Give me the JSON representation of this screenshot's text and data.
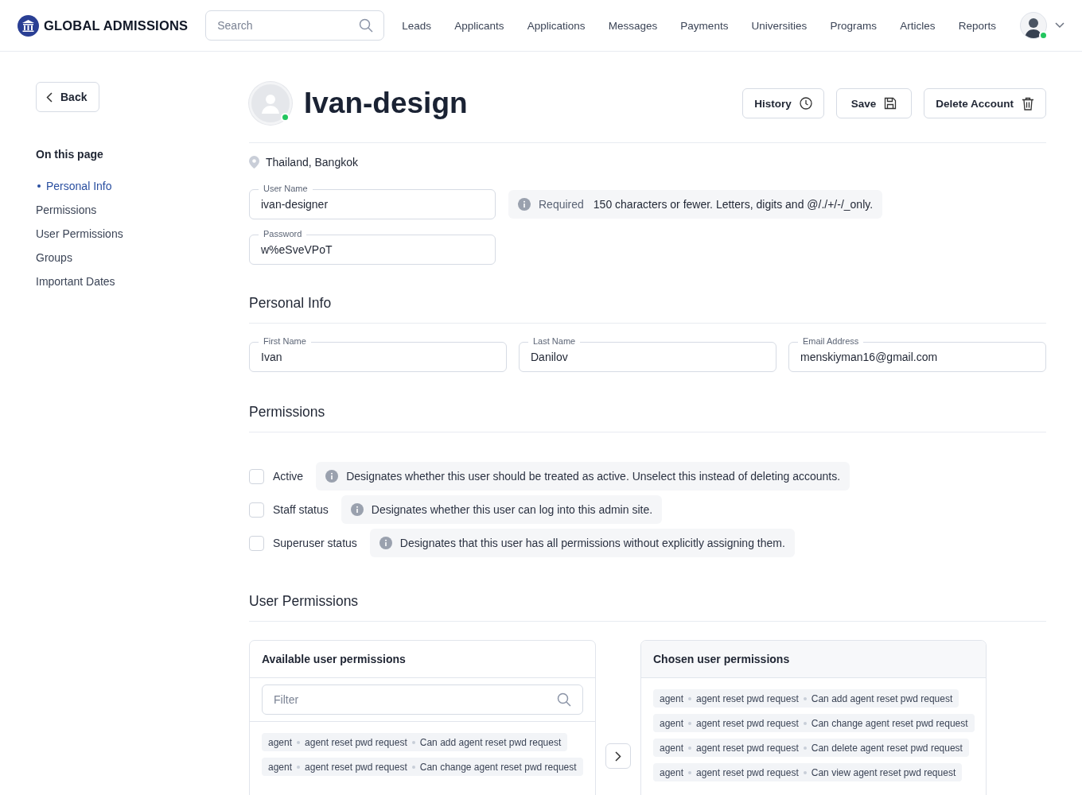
{
  "header": {
    "logo": "GLOBAL ADMISSIONS",
    "search": {
      "placeholder": "Search"
    },
    "nav": [
      "Leads",
      "Applicants",
      "Applications",
      "Messages",
      "Payments",
      "Universities",
      "Programs",
      "Articles",
      "Reports"
    ],
    "user_online": true
  },
  "sidebar": {
    "back": "Back",
    "title": "On this page",
    "items": [
      {
        "label": "Personal Info",
        "selected": true
      },
      {
        "label": "Permissions",
        "selected": false
      },
      {
        "label": "User Permissions",
        "selected": false
      },
      {
        "label": "Groups",
        "selected": false
      },
      {
        "label": "Important Dates",
        "selected": false
      }
    ]
  },
  "profile": {
    "name": "Ivan-design",
    "online": true,
    "location": "Thailand, Bangkok",
    "actions": [
      {
        "label": "History",
        "kind": "history"
      },
      {
        "label": "Save",
        "kind": "save"
      },
      {
        "label": "Delete Account",
        "kind": "delete"
      }
    ]
  },
  "account": {
    "fields": [
      {
        "label": "User Name",
        "value": "ivan-designer"
      },
      {
        "label": "Password",
        "value": "w%eSveVPoT"
      }
    ],
    "hint": {
      "tag": "Required",
      "text": "150 characters or fewer. Letters, digits and @/./+/-/_only."
    }
  },
  "personal_info": {
    "title": "Personal Info",
    "fields": [
      {
        "label": "First Name",
        "value": "Ivan"
      },
      {
        "label": "Last Name",
        "value": "Danilov"
      },
      {
        "label": "Email Address",
        "value": "menskiyman16@gmail.com"
      }
    ]
  },
  "permissions": {
    "title": "Permissions",
    "items": [
      {
        "label": "Active",
        "checked": false,
        "hint": "Designates whether this user should be treated as active. Unselect this instead of deleting accounts."
      },
      {
        "label": "Staff status",
        "checked": false,
        "hint": "Designates whether this user can log into this admin site."
      },
      {
        "label": "Superuser status",
        "checked": false,
        "hint": "Designates that this user has all permissions without explicitly assigning them."
      }
    ]
  },
  "user_permissions": {
    "title": "User Permissions",
    "available": {
      "title": "Available user permissions",
      "filter_placeholder": "Filter",
      "items": [
        [
          "agent",
          "agent reset pwd request",
          "Can add agent reset pwd request"
        ],
        [
          "agent",
          "agent reset pwd request",
          "Can change agent reset pwd request"
        ]
      ]
    },
    "chosen": {
      "title": "Chosen user permissions",
      "items": [
        [
          "agent",
          "agent reset pwd request",
          "Can add agent reset pwd request"
        ],
        [
          "agent",
          "agent reset pwd request",
          "Can change agent reset pwd request"
        ],
        [
          "agent",
          "agent reset pwd request",
          "Can delete agent reset pwd request"
        ],
        [
          "agent",
          "agent reset pwd request",
          "Can view agent reset pwd request"
        ]
      ]
    }
  }
}
